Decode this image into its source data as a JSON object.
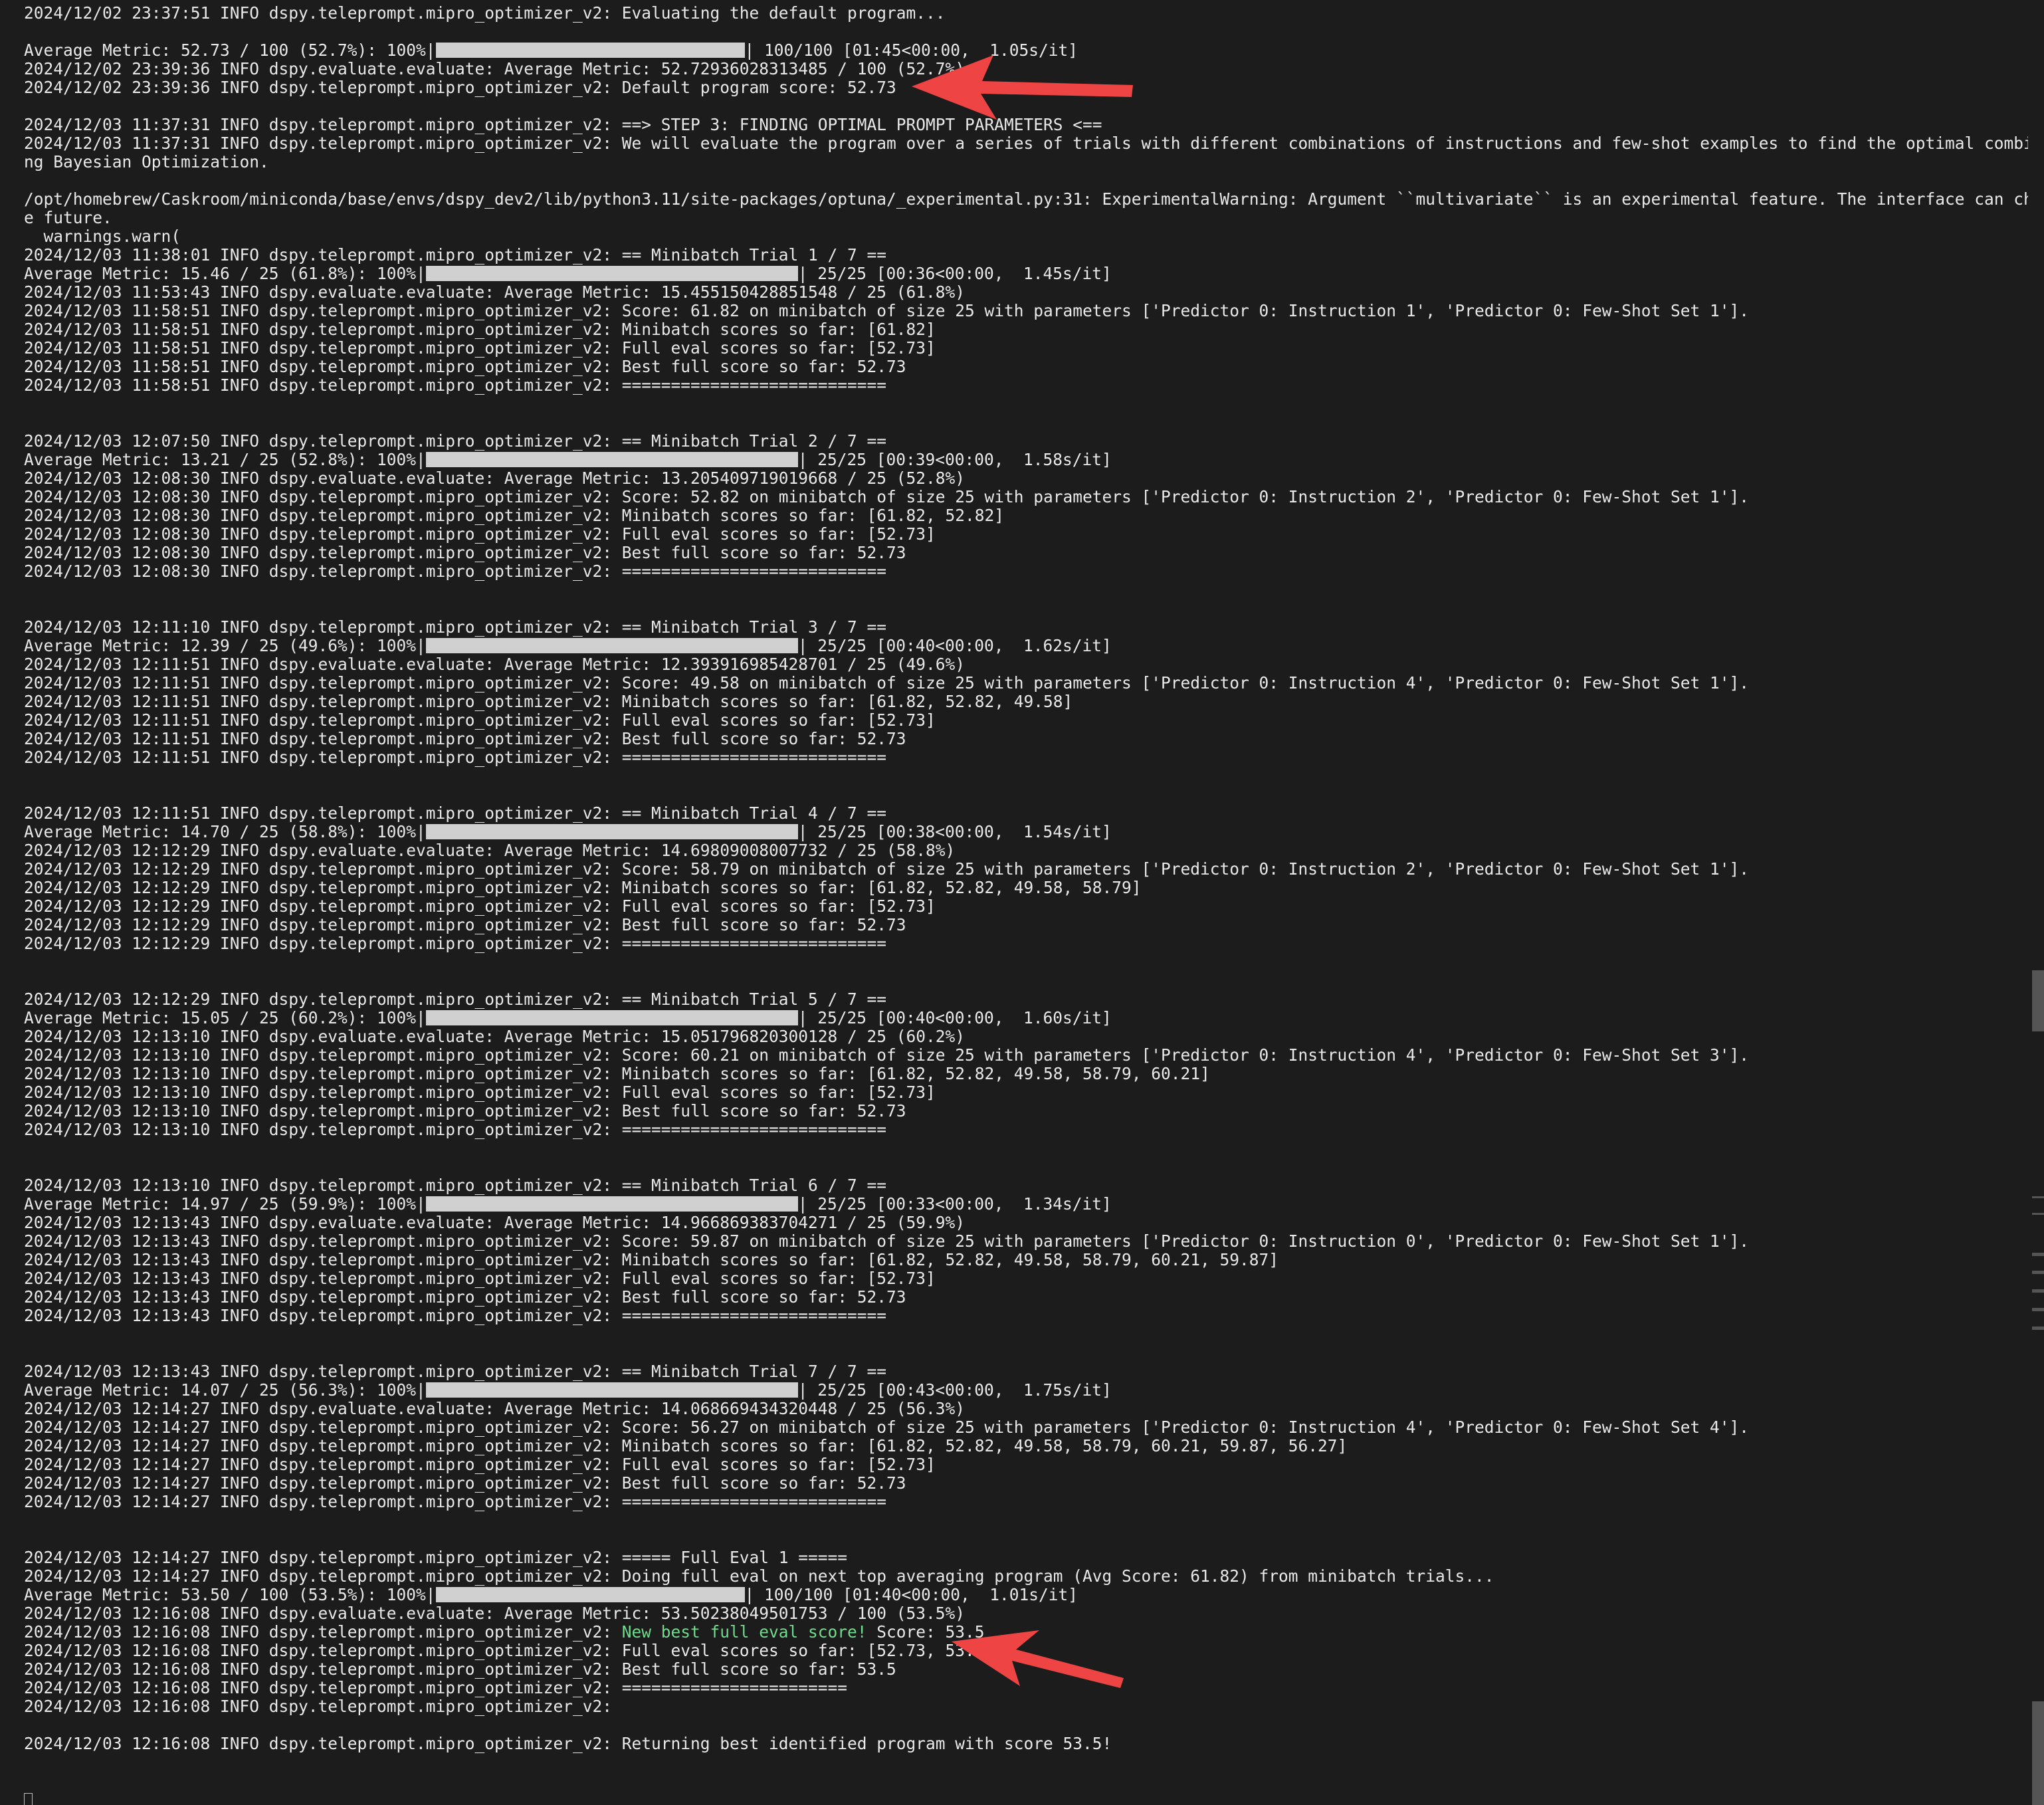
{
  "terminal": {
    "annotation_color": "#ee4444",
    "highlight_color": "#6fdc8c",
    "lines": [
      {
        "text": "2024/12/02 23:37:51 INFO dspy.teleprompt.mipro_optimizer_v2: Evaluating the default program..."
      },
      {
        "text": ""
      },
      {
        "text": "Average Metric: 52.73 / 100 (52.7%): 100%|",
        "bar": 465,
        "after": "| 100/100 [01:45<00:00,  1.05s/it]"
      },
      {
        "text": "2024/12/02 23:39:36 INFO dspy.evaluate.evaluate: Average Metric: 52.72936028313485 / 100 (52.7%)"
      },
      {
        "text": "2024/12/02 23:39:36 INFO dspy.teleprompt.mipro_optimizer_v2: Default program score: 52.73"
      },
      {
        "text": ""
      },
      {
        "text": "2024/12/03 11:37:31 INFO dspy.teleprompt.mipro_optimizer_v2: ==> STEP 3: FINDING OPTIMAL PROMPT PARAMETERS <=="
      },
      {
        "text": "2024/12/03 11:37:31 INFO dspy.teleprompt.mipro_optimizer_v2: We will evaluate the program over a series of trials with different combinations of instructions and few-shot examples to find the optimal combination usi"
      },
      {
        "text": "ng Bayesian Optimization."
      },
      {
        "text": ""
      },
      {
        "text": "/opt/homebrew/Caskroom/miniconda/base/envs/dspy_dev2/lib/python3.11/site-packages/optuna/_experimental.py:31: ExperimentalWarning: Argument ``multivariate`` is an experimental feature. The interface can change in th"
      },
      {
        "text": "e future."
      },
      {
        "text": "  warnings.warn("
      },
      {
        "text": "2024/12/03 11:38:01 INFO dspy.teleprompt.mipro_optimizer_v2: == Minibatch Trial 1 / 7 =="
      },
      {
        "text": "Average Metric: 15.46 / 25 (61.8%): 100%|",
        "bar": 560,
        "after": "| 25/25 [00:36<00:00,  1.45s/it]"
      },
      {
        "text": "2024/12/03 11:53:43 INFO dspy.evaluate.evaluate: Average Metric: 15.455150428851548 / 25 (61.8%)"
      },
      {
        "text": "2024/12/03 11:58:51 INFO dspy.teleprompt.mipro_optimizer_v2: Score: 61.82 on minibatch of size 25 with parameters ['Predictor 0: Instruction 1', 'Predictor 0: Few-Shot Set 1']."
      },
      {
        "text": "2024/12/03 11:58:51 INFO dspy.teleprompt.mipro_optimizer_v2: Minibatch scores so far: [61.82]"
      },
      {
        "text": "2024/12/03 11:58:51 INFO dspy.teleprompt.mipro_optimizer_v2: Full eval scores so far: [52.73]"
      },
      {
        "text": "2024/12/03 11:58:51 INFO dspy.teleprompt.mipro_optimizer_v2: Best full score so far: 52.73"
      },
      {
        "text": "2024/12/03 11:58:51 INFO dspy.teleprompt.mipro_optimizer_v2: ==========================="
      },
      {
        "text": ""
      },
      {
        "text": ""
      },
      {
        "text": "2024/12/03 12:07:50 INFO dspy.teleprompt.mipro_optimizer_v2: == Minibatch Trial 2 / 7 =="
      },
      {
        "text": "Average Metric: 13.21 / 25 (52.8%): 100%|",
        "bar": 560,
        "after": "| 25/25 [00:39<00:00,  1.58s/it]"
      },
      {
        "text": "2024/12/03 12:08:30 INFO dspy.evaluate.evaluate: Average Metric: 13.205409719019668 / 25 (52.8%)"
      },
      {
        "text": "2024/12/03 12:08:30 INFO dspy.teleprompt.mipro_optimizer_v2: Score: 52.82 on minibatch of size 25 with parameters ['Predictor 0: Instruction 2', 'Predictor 0: Few-Shot Set 1']."
      },
      {
        "text": "2024/12/03 12:08:30 INFO dspy.teleprompt.mipro_optimizer_v2: Minibatch scores so far: [61.82, 52.82]"
      },
      {
        "text": "2024/12/03 12:08:30 INFO dspy.teleprompt.mipro_optimizer_v2: Full eval scores so far: [52.73]"
      },
      {
        "text": "2024/12/03 12:08:30 INFO dspy.teleprompt.mipro_optimizer_v2: Best full score so far: 52.73"
      },
      {
        "text": "2024/12/03 12:08:30 INFO dspy.teleprompt.mipro_optimizer_v2: ==========================="
      },
      {
        "text": ""
      },
      {
        "text": ""
      },
      {
        "text": "2024/12/03 12:11:10 INFO dspy.teleprompt.mipro_optimizer_v2: == Minibatch Trial 3 / 7 =="
      },
      {
        "text": "Average Metric: 12.39 / 25 (49.6%): 100%|",
        "bar": 560,
        "after": "| 25/25 [00:40<00:00,  1.62s/it]"
      },
      {
        "text": "2024/12/03 12:11:51 INFO dspy.evaluate.evaluate: Average Metric: 12.393916985428701 / 25 (49.6%)"
      },
      {
        "text": "2024/12/03 12:11:51 INFO dspy.teleprompt.mipro_optimizer_v2: Score: 49.58 on minibatch of size 25 with parameters ['Predictor 0: Instruction 4', 'Predictor 0: Few-Shot Set 1']."
      },
      {
        "text": "2024/12/03 12:11:51 INFO dspy.teleprompt.mipro_optimizer_v2: Minibatch scores so far: [61.82, 52.82, 49.58]"
      },
      {
        "text": "2024/12/03 12:11:51 INFO dspy.teleprompt.mipro_optimizer_v2: Full eval scores so far: [52.73]"
      },
      {
        "text": "2024/12/03 12:11:51 INFO dspy.teleprompt.mipro_optimizer_v2: Best full score so far: 52.73"
      },
      {
        "text": "2024/12/03 12:11:51 INFO dspy.teleprompt.mipro_optimizer_v2: ==========================="
      },
      {
        "text": ""
      },
      {
        "text": ""
      },
      {
        "text": "2024/12/03 12:11:51 INFO dspy.teleprompt.mipro_optimizer_v2: == Minibatch Trial 4 / 7 =="
      },
      {
        "text": "Average Metric: 14.70 / 25 (58.8%): 100%|",
        "bar": 560,
        "after": "| 25/25 [00:38<00:00,  1.54s/it]"
      },
      {
        "text": "2024/12/03 12:12:29 INFO dspy.evaluate.evaluate: Average Metric: 14.69809008007732 / 25 (58.8%)"
      },
      {
        "text": "2024/12/03 12:12:29 INFO dspy.teleprompt.mipro_optimizer_v2: Score: 58.79 on minibatch of size 25 with parameters ['Predictor 0: Instruction 2', 'Predictor 0: Few-Shot Set 1']."
      },
      {
        "text": "2024/12/03 12:12:29 INFO dspy.teleprompt.mipro_optimizer_v2: Minibatch scores so far: [61.82, 52.82, 49.58, 58.79]"
      },
      {
        "text": "2024/12/03 12:12:29 INFO dspy.teleprompt.mipro_optimizer_v2: Full eval scores so far: [52.73]"
      },
      {
        "text": "2024/12/03 12:12:29 INFO dspy.teleprompt.mipro_optimizer_v2: Best full score so far: 52.73"
      },
      {
        "text": "2024/12/03 12:12:29 INFO dspy.teleprompt.mipro_optimizer_v2: ==========================="
      },
      {
        "text": ""
      },
      {
        "text": ""
      },
      {
        "text": "2024/12/03 12:12:29 INFO dspy.teleprompt.mipro_optimizer_v2: == Minibatch Trial 5 / 7 =="
      },
      {
        "text": "Average Metric: 15.05 / 25 (60.2%): 100%|",
        "bar": 560,
        "after": "| 25/25 [00:40<00:00,  1.60s/it]"
      },
      {
        "text": "2024/12/03 12:13:10 INFO dspy.evaluate.evaluate: Average Metric: 15.051796820300128 / 25 (60.2%)"
      },
      {
        "text": "2024/12/03 12:13:10 INFO dspy.teleprompt.mipro_optimizer_v2: Score: 60.21 on minibatch of size 25 with parameters ['Predictor 0: Instruction 4', 'Predictor 0: Few-Shot Set 3']."
      },
      {
        "text": "2024/12/03 12:13:10 INFO dspy.teleprompt.mipro_optimizer_v2: Minibatch scores so far: [61.82, 52.82, 49.58, 58.79, 60.21]"
      },
      {
        "text": "2024/12/03 12:13:10 INFO dspy.teleprompt.mipro_optimizer_v2: Full eval scores so far: [52.73]"
      },
      {
        "text": "2024/12/03 12:13:10 INFO dspy.teleprompt.mipro_optimizer_v2: Best full score so far: 52.73"
      },
      {
        "text": "2024/12/03 12:13:10 INFO dspy.teleprompt.mipro_optimizer_v2: ==========================="
      },
      {
        "text": ""
      },
      {
        "text": ""
      },
      {
        "text": "2024/12/03 12:13:10 INFO dspy.teleprompt.mipro_optimizer_v2: == Minibatch Trial 6 / 7 =="
      },
      {
        "text": "Average Metric: 14.97 / 25 (59.9%): 100%|",
        "bar": 560,
        "after": "| 25/25 [00:33<00:00,  1.34s/it]"
      },
      {
        "text": "2024/12/03 12:13:43 INFO dspy.evaluate.evaluate: Average Metric: 14.966869383704271 / 25 (59.9%)"
      },
      {
        "text": "2024/12/03 12:13:43 INFO dspy.teleprompt.mipro_optimizer_v2: Score: 59.87 on minibatch of size 25 with parameters ['Predictor 0: Instruction 0', 'Predictor 0: Few-Shot Set 1']."
      },
      {
        "text": "2024/12/03 12:13:43 INFO dspy.teleprompt.mipro_optimizer_v2: Minibatch scores so far: [61.82, 52.82, 49.58, 58.79, 60.21, 59.87]"
      },
      {
        "text": "2024/12/03 12:13:43 INFO dspy.teleprompt.mipro_optimizer_v2: Full eval scores so far: [52.73]"
      },
      {
        "text": "2024/12/03 12:13:43 INFO dspy.teleprompt.mipro_optimizer_v2: Best full score so far: 52.73"
      },
      {
        "text": "2024/12/03 12:13:43 INFO dspy.teleprompt.mipro_optimizer_v2: ==========================="
      },
      {
        "text": ""
      },
      {
        "text": ""
      },
      {
        "text": "2024/12/03 12:13:43 INFO dspy.teleprompt.mipro_optimizer_v2: == Minibatch Trial 7 / 7 =="
      },
      {
        "text": "Average Metric: 14.07 / 25 (56.3%): 100%|",
        "bar": 560,
        "after": "| 25/25 [00:43<00:00,  1.75s/it]"
      },
      {
        "text": "2024/12/03 12:14:27 INFO dspy.evaluate.evaluate: Average Metric: 14.068669434320448 / 25 (56.3%)"
      },
      {
        "text": "2024/12/03 12:14:27 INFO dspy.teleprompt.mipro_optimizer_v2: Score: 56.27 on minibatch of size 25 with parameters ['Predictor 0: Instruction 4', 'Predictor 0: Few-Shot Set 4']."
      },
      {
        "text": "2024/12/03 12:14:27 INFO dspy.teleprompt.mipro_optimizer_v2: Minibatch scores so far: [61.82, 52.82, 49.58, 58.79, 60.21, 59.87, 56.27]"
      },
      {
        "text": "2024/12/03 12:14:27 INFO dspy.teleprompt.mipro_optimizer_v2: Full eval scores so far: [52.73]"
      },
      {
        "text": "2024/12/03 12:14:27 INFO dspy.teleprompt.mipro_optimizer_v2: Best full score so far: 52.73"
      },
      {
        "text": "2024/12/03 12:14:27 INFO dspy.teleprompt.mipro_optimizer_v2: ==========================="
      },
      {
        "text": ""
      },
      {
        "text": ""
      },
      {
        "text": "2024/12/03 12:14:27 INFO dspy.teleprompt.mipro_optimizer_v2: ===== Full Eval 1 ====="
      },
      {
        "text": "2024/12/03 12:14:27 INFO dspy.teleprompt.mipro_optimizer_v2: Doing full eval on next top averaging program (Avg Score: 61.82) from minibatch trials..."
      },
      {
        "text": "Average Metric: 53.50 / 100 (53.5%): 100%|",
        "bar": 465,
        "after": "| 100/100 [01:40<00:00,  1.01s/it]"
      },
      {
        "text": "2024/12/03 12:16:08 INFO dspy.evaluate.evaluate: Average Metric: 53.50238049501753 / 100 (53.5%)"
      },
      {
        "text": "2024/12/03 12:16:08 INFO dspy.teleprompt.mipro_optimizer_v2: ",
        "highlight": "New best full eval score!",
        "after": " Score: 53.5"
      },
      {
        "text": "2024/12/03 12:16:08 INFO dspy.teleprompt.mipro_optimizer_v2: Full eval scores so far: [52.73, 53.5]"
      },
      {
        "text": "2024/12/03 12:16:08 INFO dspy.teleprompt.mipro_optimizer_v2: Best full score so far: 53.5"
      },
      {
        "text": "2024/12/03 12:16:08 INFO dspy.teleprompt.mipro_optimizer_v2: ======================="
      },
      {
        "text": "2024/12/03 12:16:08 INFO dspy.teleprompt.mipro_optimizer_v2: "
      },
      {
        "text": ""
      },
      {
        "text": "2024/12/03 12:16:08 INFO dspy.teleprompt.mipro_optimizer_v2: Returning best identified program with score 53.5!"
      },
      {
        "text": ""
      },
      {
        "text": ""
      },
      {
        "text": "",
        "cursor": true
      }
    ]
  }
}
